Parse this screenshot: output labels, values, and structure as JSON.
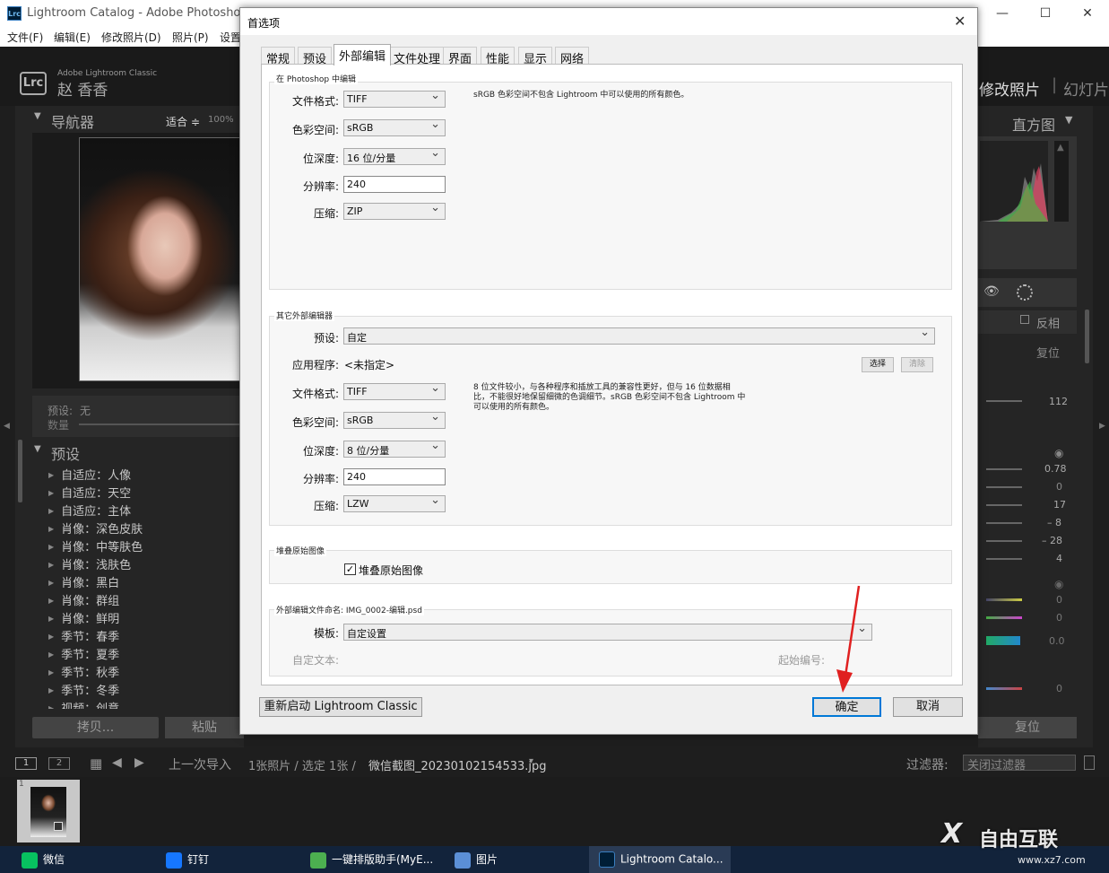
{
  "window": {
    "title": "Lightroom Catalog - Adobe Photoshop L",
    "app_icon": "Lrc",
    "controls": {
      "minimize": "—",
      "maximize": "☐",
      "close": "✕"
    }
  },
  "menu": [
    "文件(F)",
    "编辑(E)",
    "修改照片(D)",
    "照片(P)",
    "设置"
  ],
  "lr_header": {
    "brand": "Adobe Lightroom Classic",
    "user": "赵 香香",
    "logo": "Lrc",
    "modules": [
      "修改照片",
      "幻灯片"
    ]
  },
  "navigator": {
    "title": "导航器",
    "fit": "适合 ≑",
    "zoom": "100%"
  },
  "preset_info": {
    "preset_label": "预设:",
    "preset_value": "无",
    "amount_label": "数量"
  },
  "presets": {
    "title": "预设",
    "items": [
      "自适应：人像",
      "自适应：天空",
      "自适应：主体",
      "肖像：深色皮肤",
      "肖像：中等肤色",
      "肖像：浅肤色",
      "肖像：黑白",
      "肖像：群组",
      "肖像：鲜明",
      "季节：春季",
      "季节：夏季",
      "季节：秋季",
      "季节：冬季",
      "视频：创意"
    ]
  },
  "left_buttons": {
    "copy": "拷贝...",
    "paste": "粘贴"
  },
  "right_panel": {
    "histogram": "直方图",
    "invert": "反相",
    "reset_top": "复位",
    "value_112": "112",
    "values": [
      "0.78",
      "0",
      "17",
      "– 8",
      "– 28",
      "4"
    ],
    "values2": [
      "0",
      "0",
      "0.0",
      "0"
    ],
    "reset_bottom": "复位"
  },
  "filmstrip": {
    "page1": "1",
    "page2": "2",
    "source": "上一次导入",
    "count_pre": "1张照片 / 选定 1张 /",
    "filename": "微信截图_20230102154533.jpg",
    "filter_label": "过滤器:",
    "filter_value": "关闭过滤器",
    "thumb_index": "1"
  },
  "dialog": {
    "title": "首选项",
    "tabs": [
      "常规",
      "预设",
      "外部编辑",
      "文件处理",
      "界面",
      "性能",
      "显示",
      "网络"
    ],
    "active_tab": "外部编辑",
    "ps_group": {
      "label": "在 Photoshop 中编辑",
      "fields": [
        {
          "label": "文件格式:",
          "value": "TIFF",
          "type": "select"
        },
        {
          "label": "色彩空间:",
          "value": "sRGB",
          "type": "select"
        },
        {
          "label": "位深度:",
          "value": "16 位/分量",
          "type": "select"
        },
        {
          "label": "分辨率:",
          "value": "240",
          "type": "input"
        },
        {
          "label": "压缩:",
          "value": "ZIP",
          "type": "select"
        }
      ],
      "note": "sRGB 色彩空间不包含 Lightroom 中可以使用的所有颜色。"
    },
    "other_group": {
      "label": "其它外部编辑器",
      "preset_label": "预设:",
      "preset_value": "自定",
      "app_label": "应用程序:",
      "app_value": "<未指定>",
      "choose_btn": "选择",
      "clear_btn": "清除",
      "fields": [
        {
          "label": "文件格式:",
          "value": "TIFF",
          "type": "select"
        },
        {
          "label": "色彩空间:",
          "value": "sRGB",
          "type": "select"
        },
        {
          "label": "位深度:",
          "value": "8 位/分量",
          "type": "select"
        },
        {
          "label": "分辨率:",
          "value": "240",
          "type": "input"
        },
        {
          "label": "压缩:",
          "value": "LZW",
          "type": "select"
        }
      ],
      "note1": "8 位文件较小，与各种程序和插放工具的兼容性更好，但与 16 位数据相",
      "note2": "比，不能很好地保留细微的色调细节。sRGB 色彩空间不包含 Lightroom 中",
      "note3": "可以使用的所有颜色。"
    },
    "stack_group": {
      "label": "堆叠原始图像",
      "checkbox_label": "堆叠原始图像",
      "checked": true
    },
    "naming_group": {
      "label": "外部编辑文件命名: IMG_0002-编辑.psd",
      "template_label": "模板:",
      "template_value": "自定设置",
      "custom_text_label": "自定文本:",
      "start_number_label": "起始编号:"
    },
    "restart_btn": "重新启动 Lightroom Classic",
    "ok_btn": "确定",
    "cancel_btn": "取消"
  },
  "taskbar": {
    "items": [
      {
        "label": "微信",
        "color": "#07c160"
      },
      {
        "label": "钉钉",
        "color": "#1677ff"
      },
      {
        "label": "一键排版助手(MyE...",
        "color": "#4caf50"
      },
      {
        "label": "图片",
        "color": "#5b8fd6"
      },
      {
        "label": "Lightroom Catalo...",
        "color": "#001e36"
      }
    ]
  },
  "watermark": {
    "text": "自由互联",
    "url": "www.xz7.com"
  },
  "accent_color": "#e02020"
}
